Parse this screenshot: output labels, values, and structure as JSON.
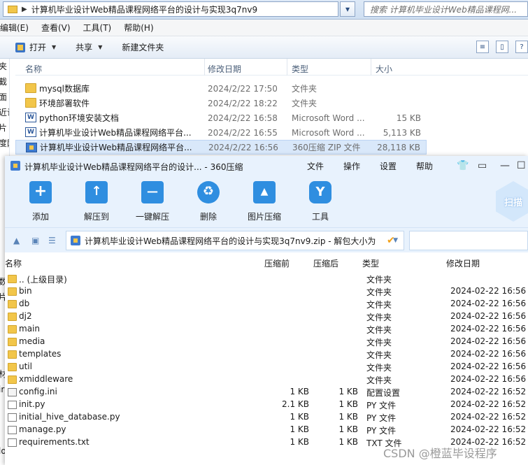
{
  "explorer": {
    "address": "计算机毕业设计Web精品课程网络平台的设计与实现3q7nv9",
    "search_placeholder": "搜索 计算机毕业设计Web精品课程网...",
    "menu": [
      "编辑(E)",
      "查看(V)",
      "工具(T)",
      "帮助(H)"
    ],
    "toolbar": {
      "open": "打开",
      "share": "共享",
      "new_folder": "新建文件夹"
    },
    "left_nav": [
      "夹",
      "截",
      "面",
      "近访",
      "片",
      "度网",
      "",
      "",
      "",
      "",
      "",
      "",
      "",
      "",
      "数",
      "片",
      "",
      "",
      "",
      "",
      "材",
      "ir",
      "",
      "",
      "",
      "lo"
    ],
    "columns": {
      "name": "名称",
      "date": "修改日期",
      "type": "类型",
      "size": "大小"
    },
    "files": [
      {
        "name": "mysql数据库",
        "date": "2024/2/22 17:50",
        "type": "文件夹",
        "size": "",
        "icon": "folder-icon"
      },
      {
        "name": "环境部署软件",
        "date": "2024/2/22 18:22",
        "type": "文件夹",
        "size": "",
        "icon": "folder-icon"
      },
      {
        "name": "python环境安装文档",
        "date": "2024/2/22 16:58",
        "type": "Microsoft Word ...",
        "size": "15 KB",
        "icon": "word-icon"
      },
      {
        "name": "计算机毕业设计Web精品课程网络平台...",
        "date": "2024/2/22 16:55",
        "type": "Microsoft Word ...",
        "size": "5,113 KB",
        "icon": "word-icon"
      },
      {
        "name": "计算机毕业设计Web精品课程网络平台...",
        "date": "2024/2/22 16:56",
        "type": "360压缩 ZIP 文件",
        "size": "28,118 KB",
        "icon": "zip-icon"
      }
    ]
  },
  "zip": {
    "title": "计算机毕业设计Web精品课程网络平台的设计... - 360压缩",
    "menu": [
      "文件",
      "操作",
      "设置",
      "帮助"
    ],
    "tools": [
      {
        "label": "添加",
        "icon": "add-icon"
      },
      {
        "label": "解压到",
        "icon": "extract-to-icon"
      },
      {
        "label": "一键解压",
        "icon": "one-click-extract-icon"
      },
      {
        "label": "删除",
        "icon": "delete-icon"
      },
      {
        "label": "图片压缩",
        "icon": "image-compress-icon"
      },
      {
        "label": "工具",
        "icon": "tools-icon"
      }
    ],
    "scan_label": "扫描",
    "path": "计算机毕业设计Web精品课程网络平台的设计与实现3q7nv9.zip - 解包大小为",
    "columns": {
      "name": "名称",
      "compressed": "压缩前",
      "original": "压缩后",
      "type": "类型",
      "modified": "修改日期"
    },
    "entries": [
      {
        "name": ".. (上级目录)",
        "before": "",
        "after": "",
        "type": "文件夹",
        "modified": "",
        "icon": "folder-icon"
      },
      {
        "name": "bin",
        "before": "",
        "after": "",
        "type": "文件夹",
        "modified": "2024-02-22 16:56",
        "icon": "folder-icon"
      },
      {
        "name": "db",
        "before": "",
        "after": "",
        "type": "文件夹",
        "modified": "2024-02-22 16:56",
        "icon": "folder-icon"
      },
      {
        "name": "dj2",
        "before": "",
        "after": "",
        "type": "文件夹",
        "modified": "2024-02-22 16:56",
        "icon": "folder-icon"
      },
      {
        "name": "main",
        "before": "",
        "after": "",
        "type": "文件夹",
        "modified": "2024-02-22 16:56",
        "icon": "folder-icon"
      },
      {
        "name": "media",
        "before": "",
        "after": "",
        "type": "文件夹",
        "modified": "2024-02-22 16:56",
        "icon": "folder-icon"
      },
      {
        "name": "templates",
        "before": "",
        "after": "",
        "type": "文件夹",
        "modified": "2024-02-22 16:56",
        "icon": "folder-icon"
      },
      {
        "name": "util",
        "before": "",
        "after": "",
        "type": "文件夹",
        "modified": "2024-02-22 16:56",
        "icon": "folder-icon"
      },
      {
        "name": "xmiddleware",
        "before": "",
        "after": "",
        "type": "文件夹",
        "modified": "2024-02-22 16:56",
        "icon": "folder-icon"
      },
      {
        "name": "config.ini",
        "before": "1 KB",
        "after": "1 KB",
        "type": "配置设置",
        "modified": "2024-02-22 16:52",
        "icon": "config-file-icon"
      },
      {
        "name": "init.py",
        "before": "2.1 KB",
        "after": "1 KB",
        "type": "PY 文件",
        "modified": "2024-02-22 16:52",
        "icon": "file-icon"
      },
      {
        "name": "initial_hive_database.py",
        "before": "1 KB",
        "after": "1 KB",
        "type": "PY 文件",
        "modified": "2024-02-22 16:52",
        "icon": "file-icon"
      },
      {
        "name": "manage.py",
        "before": "1 KB",
        "after": "1 KB",
        "type": "PY 文件",
        "modified": "2024-02-22 16:52",
        "icon": "file-icon"
      },
      {
        "name": "requirements.txt",
        "before": "1 KB",
        "after": "1 KB",
        "type": "TXT 文件",
        "modified": "2024-02-22 16:52",
        "icon": "file-icon"
      }
    ]
  },
  "watermark": "CSDN @橙蓝毕设程序"
}
